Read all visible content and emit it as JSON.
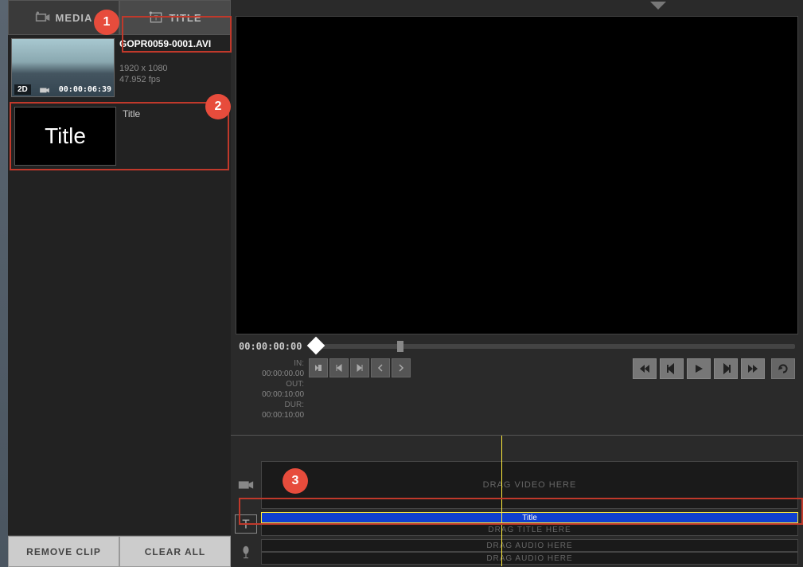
{
  "tabs": {
    "media": "MEDIA",
    "title": "TITLE"
  },
  "media_clip": {
    "name": "GOPR0059-0001.AVI",
    "badge_2d": "2D",
    "timecode": "00:00:06:39",
    "resolution": "1920 x 1080",
    "fps": "47.952 fps"
  },
  "title_clip": {
    "thumb_text": "Title",
    "label": "Title"
  },
  "bottom_buttons": {
    "remove": "REMOVE CLIP",
    "clear": "CLEAR ALL"
  },
  "transport": {
    "position": "00:00:00:00",
    "in_label": "IN:",
    "in_value": "00:00:00.00",
    "out_label": "OUT:",
    "out_value": "00:00:10:00",
    "dur_label": "DUR:",
    "dur_value": "00:00:10:00"
  },
  "timeline": {
    "video_placeholder": "DRAG VIDEO HERE",
    "title_clip_label": "Title",
    "title_placeholder": "DRAG TITLE HERE",
    "audio_placeholder_1": "DRAG AUDIO HERE",
    "audio_placeholder_2": "DRAG AUDIO HERE"
  },
  "annotations": {
    "n1": "1",
    "n2": "2",
    "n3": "3"
  }
}
